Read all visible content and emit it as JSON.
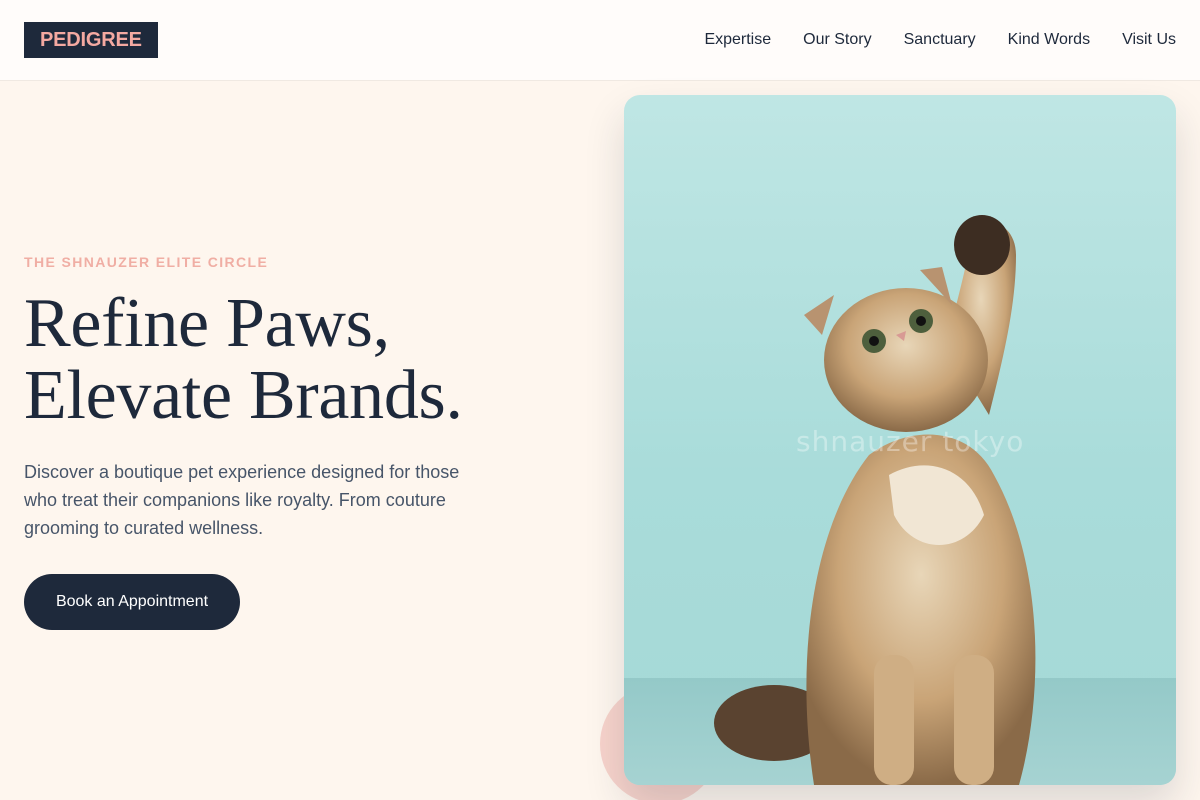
{
  "brand": {
    "logo_text": "PEDIGREE"
  },
  "nav": {
    "items": [
      {
        "label": "Expertise"
      },
      {
        "label": "Our Story"
      },
      {
        "label": "Sanctuary"
      },
      {
        "label": "Kind Words"
      },
      {
        "label": "Visit Us"
      }
    ]
  },
  "hero": {
    "eyebrow": "THE SHNAUZER ELITE CIRCLE",
    "headline_line1": "Refine Paws,",
    "headline_line2": "Elevate Brands.",
    "description": "Discover a boutique pet experience designed for those who treat their companions like royalty. From couture grooming to curated wellness.",
    "cta_label": "Book an Appointment",
    "image": {
      "subject": "kitten-raising-paw",
      "watermark": "shnauzer tokyo"
    }
  },
  "colors": {
    "navy": "#1e293b",
    "accent_pink": "#f4a9a1",
    "background": "#fef6ee",
    "photo_bg": "#bfe6e4"
  }
}
